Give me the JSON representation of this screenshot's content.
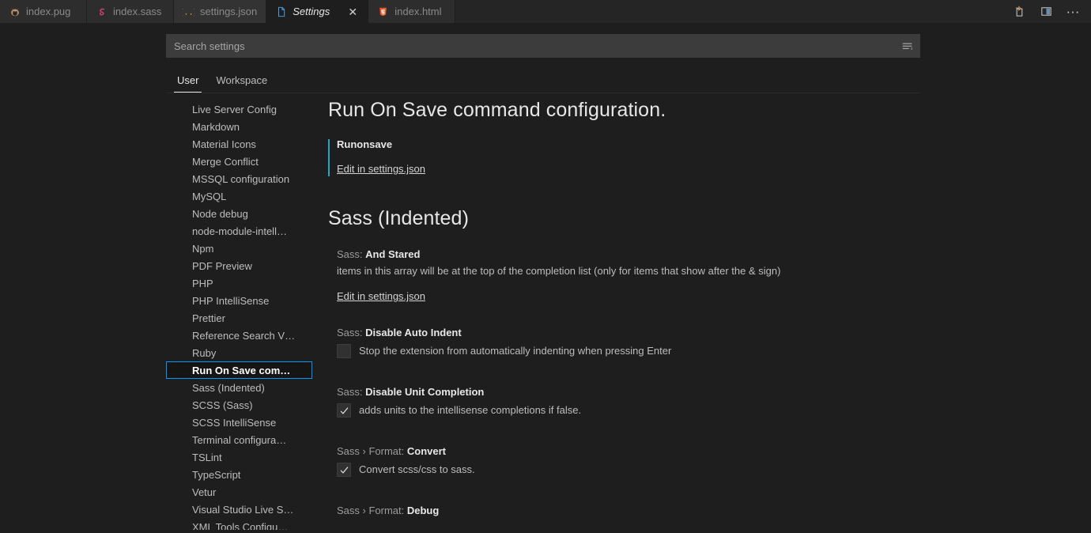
{
  "tabs": [
    {
      "label": "index.pug",
      "icon": "pug-icon",
      "state": "inactive"
    },
    {
      "label": "index.sass",
      "icon": "sass-icon",
      "state": "inactive"
    },
    {
      "label": "settings.json",
      "icon": "json-icon",
      "state": "preview"
    },
    {
      "label": "Settings",
      "icon": "settings-file-icon",
      "state": "active",
      "close": "✕"
    },
    {
      "label": "index.html",
      "icon": "html5-icon",
      "state": "inactive"
    }
  ],
  "tabbar_actions": [
    {
      "name": "split-editor-button"
    },
    {
      "name": "toggle-panel-button"
    },
    {
      "name": "more-actions-button",
      "glyph": "···"
    }
  ],
  "search": {
    "placeholder": "Search settings",
    "value": "",
    "filter_icon": "filter-icon"
  },
  "scope_tabs": [
    {
      "label": "User",
      "active": true
    },
    {
      "label": "Workspace",
      "active": false
    }
  ],
  "toc": {
    "items": [
      "Live Server Config",
      "Markdown",
      "Material Icons",
      "Merge Conflict",
      "MSSQL configuration",
      "MySQL",
      "Node debug",
      "node-module-intell…",
      "Npm",
      "PDF Preview",
      "PHP",
      "PHP IntelliSense",
      "Prettier",
      "Reference Search V…",
      "Ruby",
      "Run On Save com…",
      "Sass (Indented)",
      "SCSS (Sass)",
      "SCSS IntelliSense",
      "Terminal configura…",
      "TSLint",
      "TypeScript",
      "Vetur",
      "Visual Studio Live S…",
      "XML Tools Configu…"
    ],
    "selected_index": 15
  },
  "content": {
    "section1": {
      "title": "Run On Save command configuration.",
      "group_key": "Runonsave",
      "edit_link": "Edit in settings.json"
    },
    "section2": {
      "title": "Sass (Indented)",
      "settings": [
        {
          "prefix": "Sass: ",
          "name": "And Stared",
          "description": "items in this array will be at the top of the completion list (only for items that show after the & sign)",
          "edit_link": "Edit in settings.json",
          "control": "link"
        },
        {
          "prefix": "Sass: ",
          "name": "Disable Auto Indent",
          "description": "Stop the extension from automatically indenting when pressing Enter",
          "control": "checkbox",
          "checked": false
        },
        {
          "prefix": "Sass: ",
          "name": "Disable Unit Completion",
          "description": "adds units to the intellisense completions if false.",
          "control": "checkbox",
          "checked": true
        },
        {
          "prefix": "Sass › Format: ",
          "name": "Convert",
          "description": "Convert scss/css to sass.",
          "control": "checkbox",
          "checked": true
        },
        {
          "prefix": "Sass › Format: ",
          "name": "Debug",
          "description": "",
          "control": "none"
        }
      ]
    }
  },
  "colors": {
    "editor_background": "#1e1e1e",
    "tabbar_background": "#252526",
    "accent_blue": "#0097fb",
    "group_accent": "#2aa3c4",
    "input_background": "#3c3c3c"
  }
}
